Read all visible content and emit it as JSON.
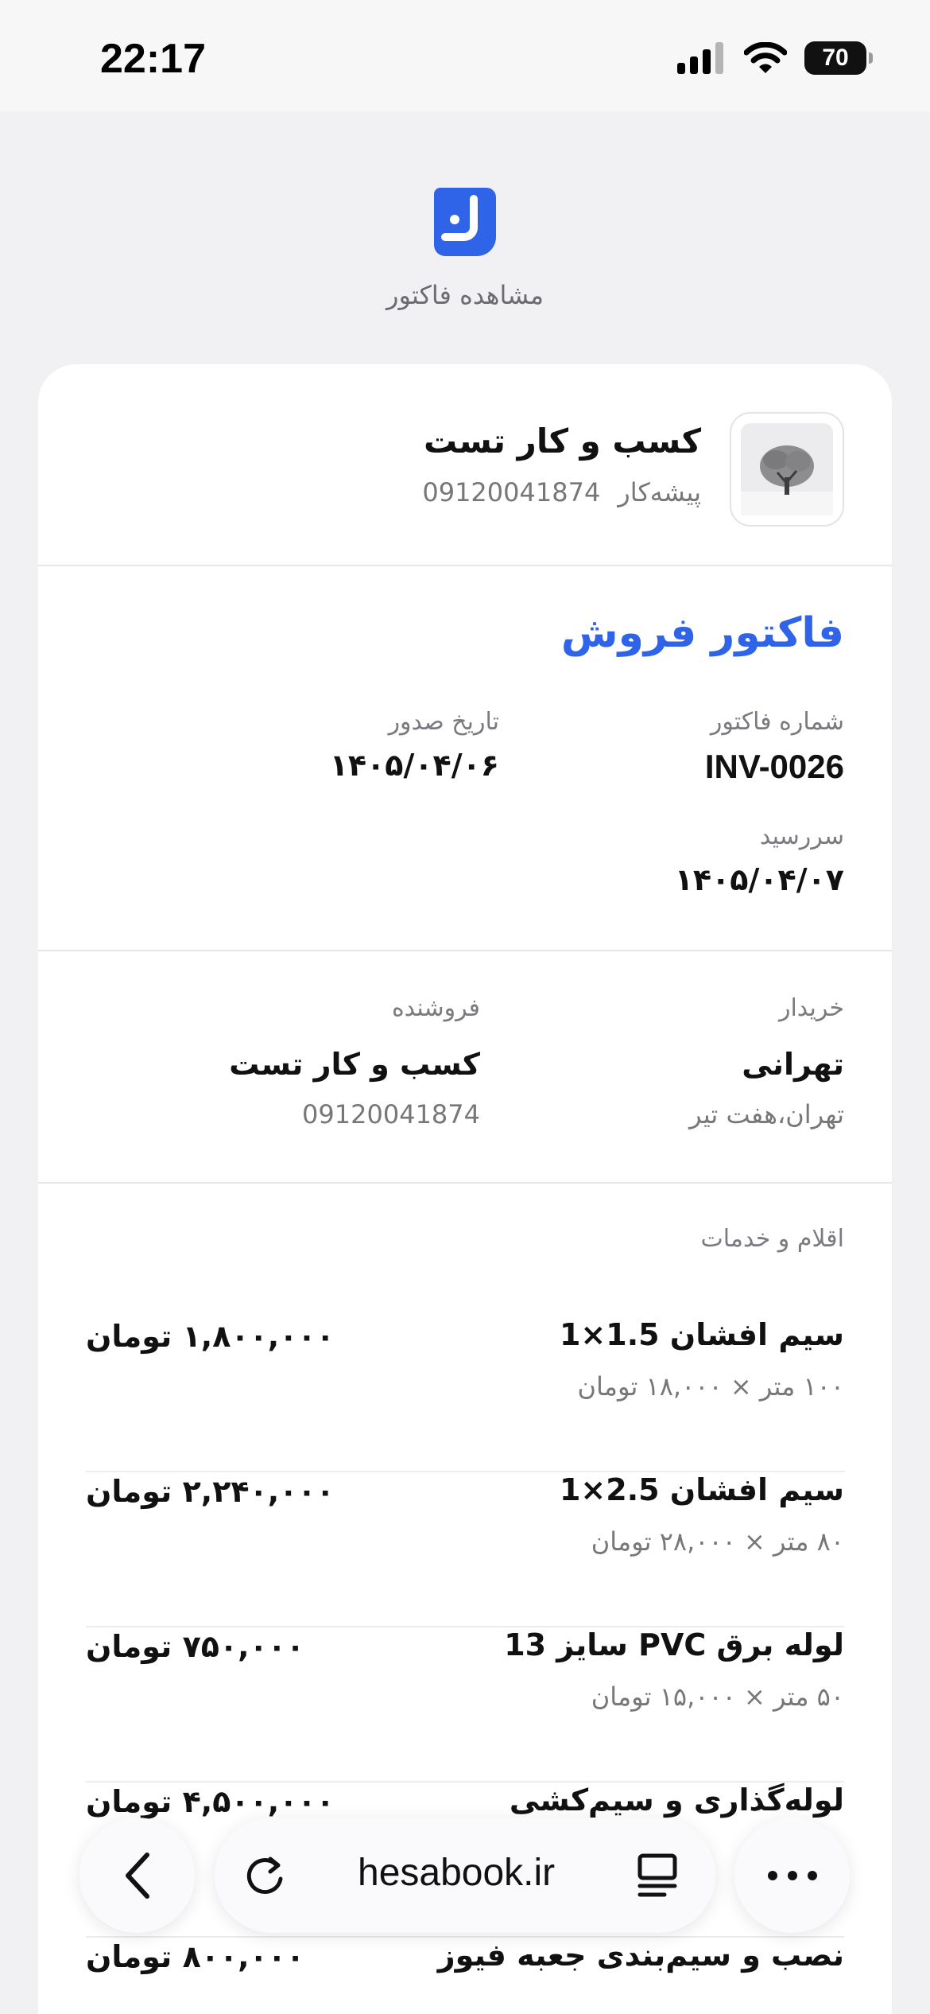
{
  "status": {
    "time": "22:17",
    "battery": "70"
  },
  "header": {
    "title": "مشاهده فاکتور"
  },
  "business": {
    "name": "کسب و کار تست",
    "type": "پیشه‌کار",
    "phone": "09120041874"
  },
  "invoice": {
    "title": "فاکتور فروش",
    "number_label": "شماره فاکتور",
    "number": "INV-0026",
    "issue_label": "تاریخ صدور",
    "issue_date": "۱۴۰۵/۰۴/۰۶",
    "due_label": "سررسید",
    "due_date": "۱۴۰۵/۰۴/۰۷"
  },
  "buyer": {
    "label": "خریدار",
    "name": "تهرانی",
    "address": "تهران،هفت تیر"
  },
  "seller": {
    "label": "فروشنده",
    "name": "کسب و کار تست",
    "phone": "09120041874"
  },
  "items_label": "اقلام و خدمات",
  "items": [
    {
      "name": "سیم افشان 1.5×1",
      "desc": "۱۰۰ متر × ۱۸,۰۰۰ تومان",
      "total": "۱,۸۰۰,۰۰۰ تومان"
    },
    {
      "name": "سیم افشان 2.5×1",
      "desc": "۸۰ متر × ۲۸,۰۰۰ تومان",
      "total": "۲,۲۴۰,۰۰۰ تومان"
    },
    {
      "name": "لوله برق PVC سایز 13",
      "desc": "۵۰ متر × ۱۵,۰۰۰ تومان",
      "total": "۷۵۰,۰۰۰ تومان"
    },
    {
      "name": "لوله‌گذاری و سیم‌کشی",
      "desc": "",
      "total": "۴,۵۰۰,۰۰۰ تومان"
    },
    {
      "name": "نصب و سیم‌بندی جعبه فیوز",
      "desc": "",
      "total": "۸۰۰,۰۰۰ تومان"
    }
  ],
  "browser": {
    "url": "hesabook.ir"
  },
  "colors": {
    "accent": "#2f63e8",
    "background": "#f1f1f3"
  }
}
